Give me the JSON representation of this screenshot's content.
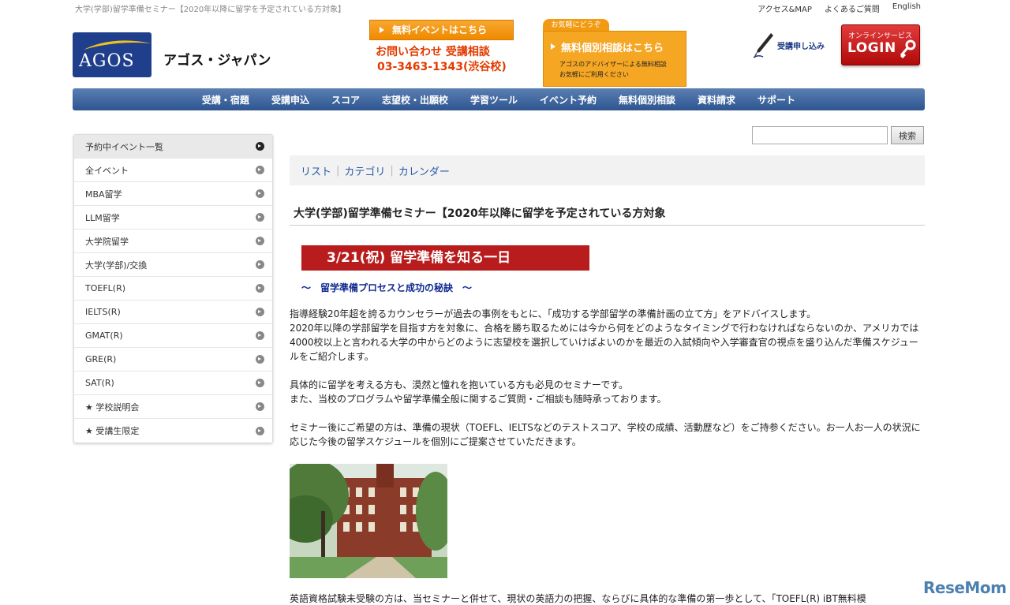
{
  "header": {
    "page_title": "大学(学部)留学準備セミナー【2020年以降に留学を予定されている方対象】",
    "top_links": [
      "アクセス&MAP",
      "よくあるご質問",
      "English"
    ],
    "brand_logo_text": "AGOS",
    "brand_name": "アゴス・ジャパン",
    "event_button": "無料イベントはこちら",
    "contact_line1": "お問い合わせ 受講相談",
    "contact_line2": "03-3463-1343(渋谷校)",
    "consult_tag": "お気軽にどうぞ",
    "consult_title": "無料個別相談はこちら",
    "consult_sub1": "アゴスのアドバイザーによる無料相談",
    "consult_sub2": "お気軽にご利用ください",
    "apply_label": "受講申し込み",
    "login_top": "オンラインサービス",
    "login_main": "LOGIN"
  },
  "nav": [
    "受講・宿題",
    "受講申込",
    "スコア",
    "志望校・出願校",
    "学習ツール",
    "イベント予約",
    "無料個別相談",
    "資料請求",
    "サポート"
  ],
  "sidebar": {
    "items": [
      "予約中イベント一覧",
      "全イベント",
      "MBA留学",
      "LLM留学",
      "大学院留学",
      "大学(学部)/交換",
      "TOEFL(R)",
      "IELTS(R)",
      "GMAT(R)",
      "GRE(R)",
      "SAT(R)",
      "★ 学校説明会",
      "★ 受講生限定"
    ]
  },
  "search": {
    "button": "検索",
    "value": ""
  },
  "view_tabs": [
    "リスト",
    "カテゴリ",
    "カレンダー"
  ],
  "article": {
    "title": "大学(学部)留学準備セミナー【2020年以降に留学を予定されている方対象",
    "banner": "3/21(祝) 留学準備を知る一日",
    "subhead": "～　留学準備プロセスと成功の秘訣　～",
    "p1": "指導経験20年超を誇るカウンセラーが過去の事例をもとに、「成功する学部留学の準備計画の立て方」をアドバイスします。\n2020年以降の学部留学を目指す方を対象に、合格を勝ち取るためには今から何をどのようなタイミングで行わなければならないのか、アメリカでは4000校以上と言われる大学の中からどのように志望校を選択していけばよいのかを最近の入試傾向や入学審査官の視点を盛り込んだ準備スケジュールをご紹介します。",
    "p2": "具体的に留学を考える方も、漠然と憧れを抱いている方も必見のセミナーです。\nまた、当校のプログラムや留学準備全般に関するご質問・ご相談も随時承っております。",
    "p3": "セミナー後にご希望の方は、準備の現状（TOEFL、IELTSなどのテストスコア、学校の成績、活動歴など）をご持参ください。お一人お一人の状況に応じた今後の留学スケジュールを個別にご提案させていただきます。",
    "p4": "英語資格試験未受験の方は、当セミナーと併せて、現状の英語力の把握、ならびに具体的な準備の第一歩として、「TOEFL(R) iBT無料模"
  },
  "watermark": "ReseMom",
  "colors": {
    "nav": "#2e5590",
    "accent_orange": "#f5a623",
    "banner_red": "#b81c1c",
    "link_blue": "#2a5aa8"
  }
}
